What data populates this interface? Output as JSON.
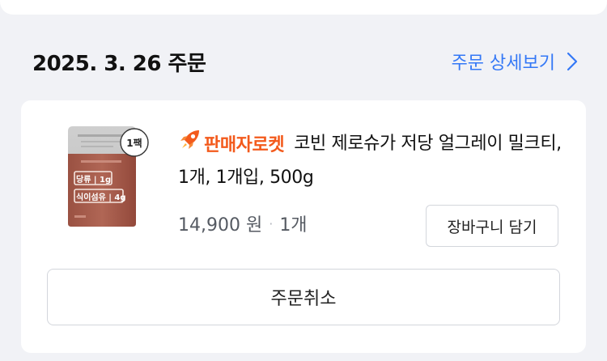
{
  "order": {
    "date": "2025. 3. 26 주문",
    "detail_link": "주문 상세보기"
  },
  "product": {
    "badge_label": "판매자로켓",
    "name": "코빈 제로슈가 저당 얼그레이 밀크티, 1개, 1개입, 500g",
    "price": "14,900 원",
    "separator": "·",
    "quantity": "1개",
    "pack_label": "1팩",
    "package_text": {
      "sugar": "당류 | 1g",
      "fiber": "식이섬유 | 4g"
    }
  },
  "actions": {
    "add_to_cart": "장바구니 담기",
    "cancel_order": "주문취소"
  },
  "colors": {
    "link": "#3478f6",
    "rocket_badge": "#f35a1c",
    "package_body": "#a55a4a",
    "package_top": "#c9c9c9"
  }
}
